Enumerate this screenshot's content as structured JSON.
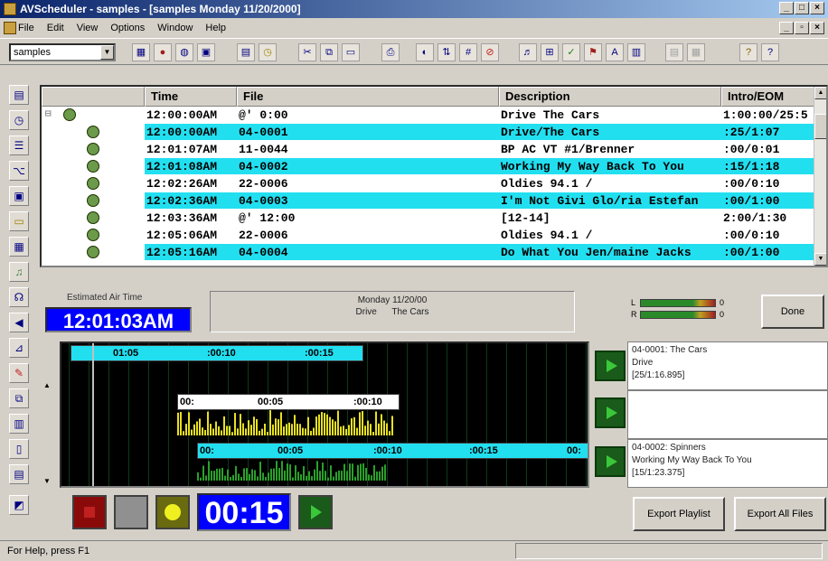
{
  "window": {
    "title": "AVScheduler - samples - [samples Monday 11/20/2000]"
  },
  "menu": [
    "File",
    "Edit",
    "View",
    "Options",
    "Window",
    "Help"
  ],
  "toolbar": {
    "schedule_combo": "samples"
  },
  "grid": {
    "headers": {
      "time": "Time",
      "file": "File",
      "description": "Description",
      "intro": "Intro/EOM"
    },
    "rows": [
      {
        "time": "12:00:00AM",
        "file": "@' 0:00",
        "description": "Drive      The Cars",
        "intro": "1:00:00/25:5",
        "highlight": false,
        "icon": "clock-icon"
      },
      {
        "time": "12:00:00AM",
        "file": "04-0001",
        "description": "Drive/The Cars",
        "intro": ":25/1:07",
        "highlight": true,
        "icon": "song-icon"
      },
      {
        "time": "12:01:07AM",
        "file": "11-0044",
        "description": "BP AC VT #1/Brenner",
        "intro": ":00/0:01",
        "highlight": false,
        "icon": "voice-icon"
      },
      {
        "time": "12:01:08AM",
        "file": "04-0002",
        "description": "Working My Way Back To You",
        "intro": ":15/1:18",
        "highlight": true,
        "icon": "song-icon"
      },
      {
        "time": "12:02:26AM",
        "file": "22-0006",
        "description": "Oldies 94.1    /",
        "intro": ":00/0:10",
        "highlight": false,
        "icon": "jingle-icon"
      },
      {
        "time": "12:02:36AM",
        "file": "04-0003",
        "description": "I'm Not Givi Glo/ria Estefan",
        "intro": ":00/1:00",
        "highlight": true,
        "icon": "song-icon"
      },
      {
        "time": "12:03:36AM",
        "file": "@' 12:00",
        "description": "[12-14]",
        "intro": "2:00/1:30",
        "highlight": false,
        "icon": "break-icon"
      },
      {
        "time": "12:05:06AM",
        "file": "22-0006",
        "description": "Oldies 94.1    /",
        "intro": ":00/0:10",
        "highlight": false,
        "icon": "jingle-icon"
      },
      {
        "time": "12:05:16AM",
        "file": "04-0004",
        "description": "Do What You Jen/maine Jacks",
        "intro": ":00/1:00",
        "highlight": true,
        "icon": "song-icon"
      }
    ]
  },
  "air": {
    "label": "Estimated Air Time",
    "time": "12:01:03AM",
    "info_line1": "Monday 11/20/00",
    "info_line2_title": "Drive",
    "info_line2_artist": "The Cars"
  },
  "meters": {
    "left_label": "L",
    "right_label": "R",
    "left_end": "0",
    "right_end": "0"
  },
  "done_button": "Done",
  "timeline": {
    "ruler1": [
      "01:05",
      ":00:10",
      ":00:15"
    ],
    "ruler2": [
      "00:",
      "00:05",
      ":00:10"
    ],
    "ruler3": [
      "00:",
      "00:05",
      ":00:10",
      ":00:15",
      "00:"
    ]
  },
  "cues": [
    {
      "line1": "04-0001: The Cars",
      "line2": "Drive",
      "line3": "[25/1:16.895]"
    },
    {
      "line1": "",
      "line2": "",
      "line3": ""
    },
    {
      "line1": "04-0002: Spinners",
      "line2": "Working My Way Back To You",
      "line3": "[15/1:23.375]"
    }
  ],
  "counter": "00:15",
  "export_playlist": "Export Playlist",
  "export_all": "Export All Files",
  "status": "For Help, press F1"
}
